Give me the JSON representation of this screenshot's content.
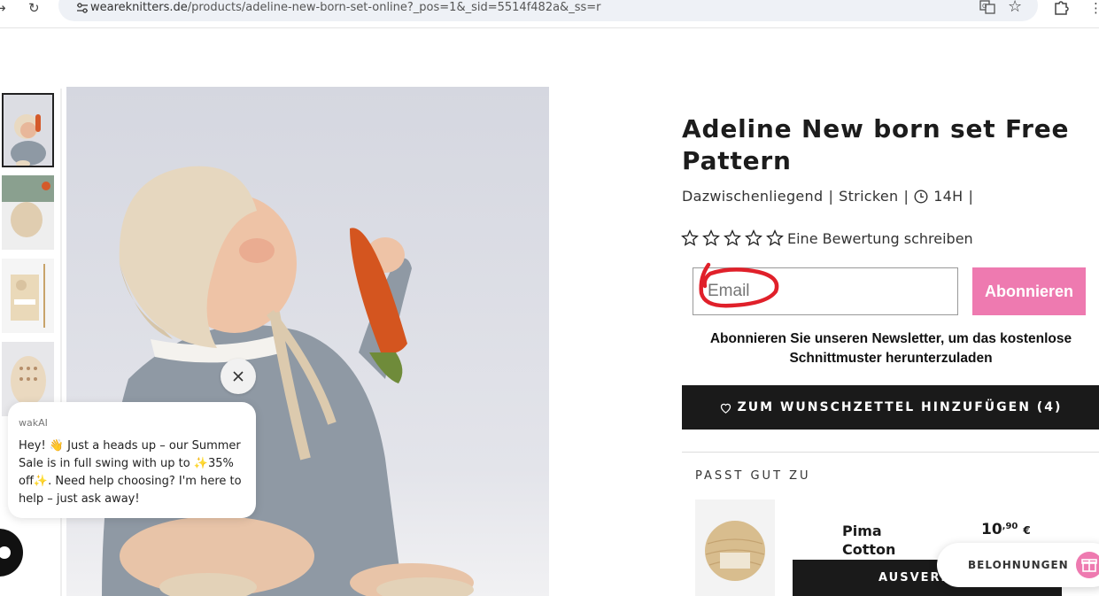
{
  "browser": {
    "url_domain": "weareknitters.de",
    "url_path": "/products/adeline-new-born-set-online?_pos=1&_sid=5514f482a&_ss=r"
  },
  "product": {
    "title": "Adeline New born set Free Pattern",
    "level": "Dazwischenliegend",
    "craft": "Stricken",
    "duration": "14H",
    "separator": "|",
    "review_link": "Eine Bewertung schreiben",
    "rating_stars": 5
  },
  "newsletter": {
    "email_placeholder": "Email",
    "subscribe_label": "Abonnieren",
    "description": "Abonnieren Sie unseren Newsletter, um das kostenlose Schnittmuster herunterzuladen"
  },
  "wishlist": {
    "label": "ZUM WUNSCHZETTEL HINZUFÜGEN (4)"
  },
  "related": {
    "heading": "PASST GUT ZU",
    "item_name": "Pima Cotton Sand",
    "price_main": "10",
    "price_cents": ",90",
    "price_currency": "€",
    "button_label": "AUSVERKAUFT"
  },
  "rewards": {
    "label": "BELOHNUNGEN"
  },
  "chat": {
    "sender": "wakAI",
    "message": "Hey! 👋 Just a heads up – our Summer Sale is in full swing with up to ✨35% off✨. Need help choosing? I'm here to help – just ask away!"
  },
  "colors": {
    "accent_pink": "#ee7ab0",
    "dark": "#1a1a1a",
    "annotation_red": "#e0202a"
  }
}
